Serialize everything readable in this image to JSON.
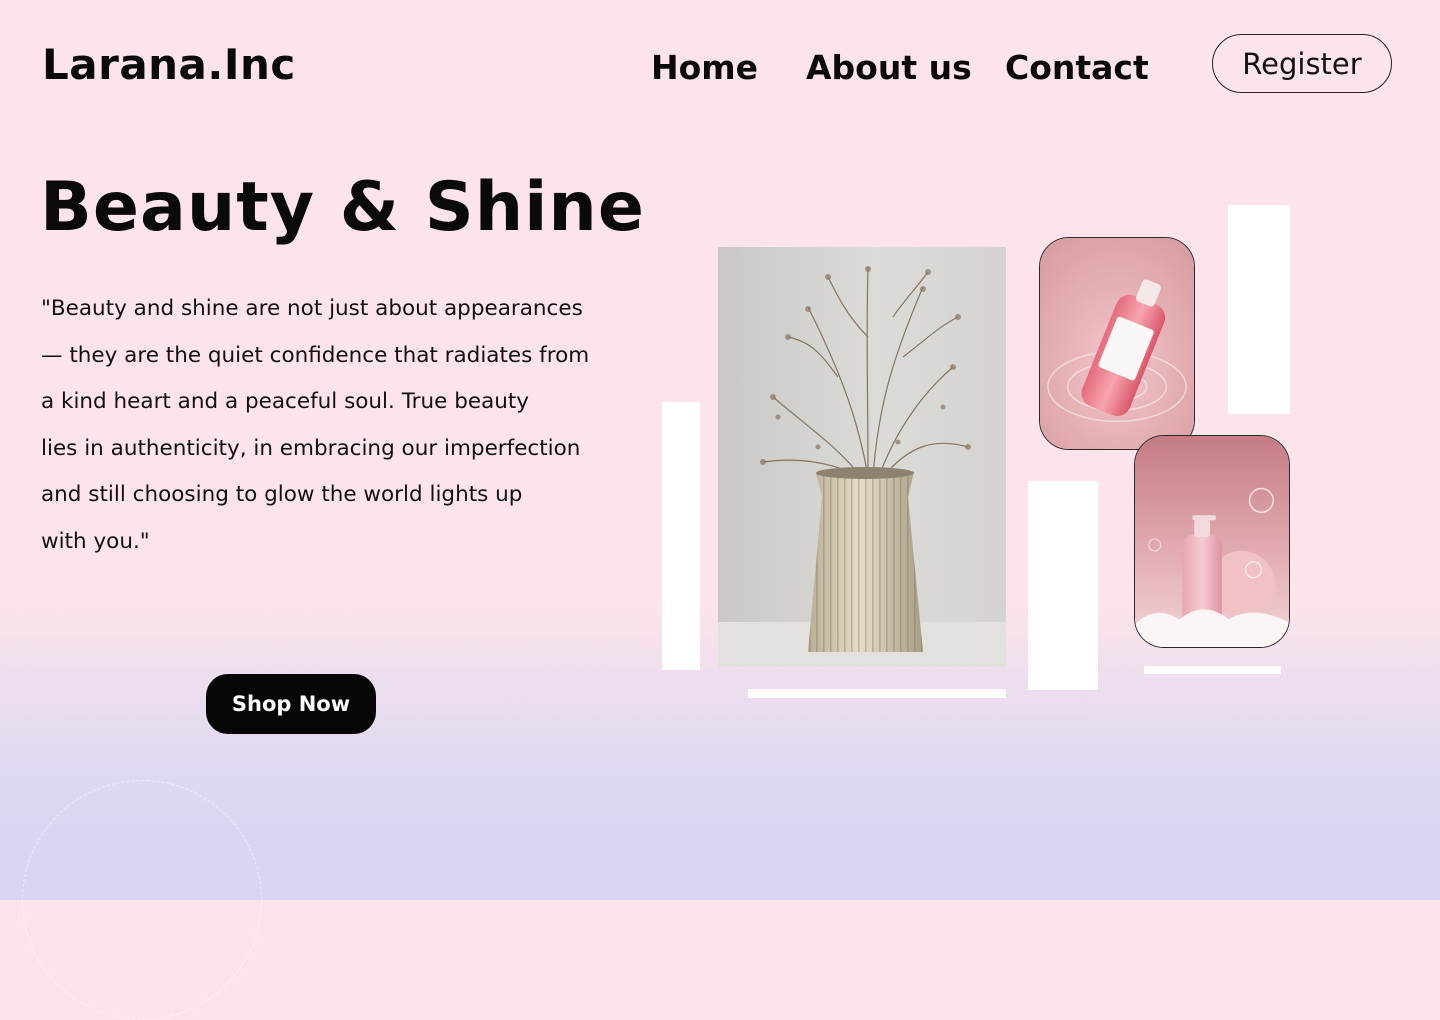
{
  "brand": {
    "name": "Larana.Inc"
  },
  "nav": {
    "links": [
      "Home",
      "About us",
      "Contact"
    ],
    "register_label": "Register"
  },
  "hero": {
    "title": "Beauty & Shine",
    "quote_lines": [
      "\"Beauty and shine are not just about appearances",
      "— they are the quiet confidence that radiates from",
      "a kind heart and a peaceful soul. True beauty",
      "lies in authenticity, in embracing our imperfection",
      "and still choosing to glow the world lights up",
      "with you.\""
    ],
    "cta_label": "Shop Now"
  },
  "gallery": [
    {
      "subject": "dried flowers in a ribbed ceramic vase"
    },
    {
      "subject": "pink serum bottle in water"
    },
    {
      "subject": "pink lotion pump bottle with bubbles"
    }
  ],
  "colors": {
    "background_top": "#fde4ea",
    "background_bottom": "#dad4f4",
    "button": "#050505",
    "text": "#0a0a0a"
  }
}
